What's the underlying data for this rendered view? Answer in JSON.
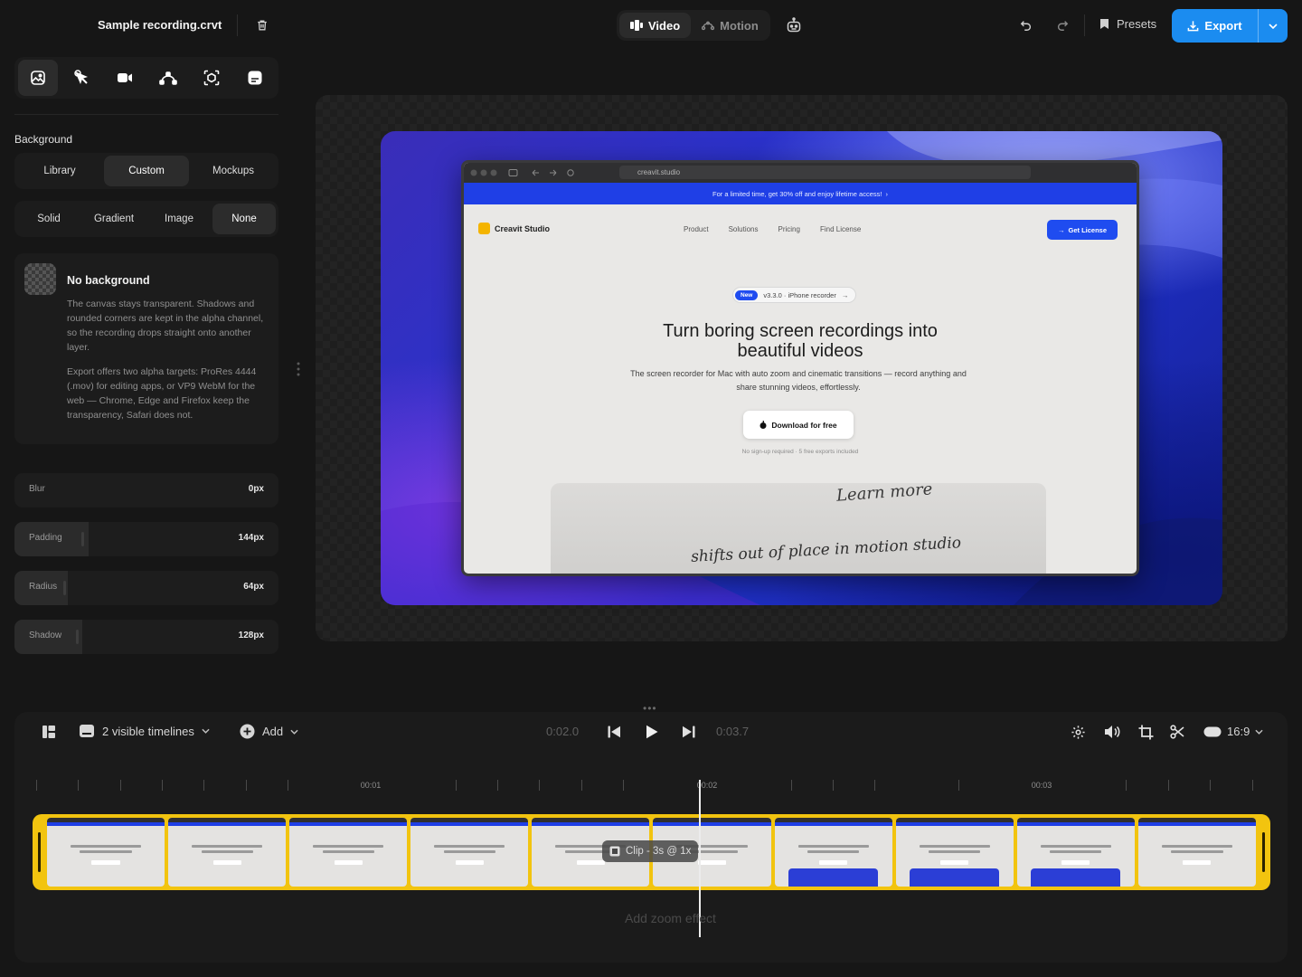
{
  "header": {
    "file_name": "Sample recording.crvt",
    "mode_tabs": [
      {
        "label": "Video",
        "active": true,
        "icon": "video-mode-icon"
      },
      {
        "label": "Motion",
        "active": false,
        "icon": "motion-mode-icon"
      }
    ],
    "presets_label": "Presets",
    "export_label": "Export",
    "accent": "#1b8cf0"
  },
  "sidebar": {
    "tools": [
      "background-icon",
      "cursor-icon",
      "camera-icon",
      "motion-path-icon",
      "focus-icon",
      "captions-icon"
    ],
    "section_title": "Background",
    "source_tabs": [
      {
        "label": "Library",
        "active": false
      },
      {
        "label": "Custom",
        "active": true
      },
      {
        "label": "Mockups",
        "active": false
      }
    ],
    "type_tabs": [
      {
        "label": "Solid",
        "active": false
      },
      {
        "label": "Gradient",
        "active": false
      },
      {
        "label": "Image",
        "active": false
      },
      {
        "label": "None",
        "active": true
      }
    ],
    "info": {
      "title": "No background",
      "p1": "The canvas stays transparent. Shadows and rounded corners are kept in the alpha channel, so the recording drops straight onto another layer.",
      "p2": "Export offers two alpha targets: ProRes 4444 (.mov) for editing apps, or VP9 WebM for the web — Chrome, Edge and Firefox keep the transparency, Safari does not."
    },
    "sliders": [
      {
        "label": "Blur",
        "value": "0px",
        "fraction": 0.0
      },
      {
        "label": "Padding",
        "value": "144px",
        "fraction": 0.28
      },
      {
        "label": "Radius",
        "value": "64px",
        "fraction": 0.2
      },
      {
        "label": "Shadow",
        "value": "128px",
        "fraction": 0.25
      }
    ]
  },
  "preview": {
    "url": "creavit.studio",
    "promo": "For a limited time, get 30% off and enjoy lifetime access!",
    "brand": "Creavit Studio",
    "nav": [
      "Product",
      "Solutions",
      "Pricing",
      "Find License"
    ],
    "cta": "Get License",
    "badge_new": "New",
    "badge_text": "v3.3.0 · iPhone recorder",
    "hero_line1": "Turn boring screen recordings into",
    "hero_line2": "beautiful videos",
    "hero_sub": "The screen recorder for Mac with auto zoom and cinematic transitions — record anything and share stunning videos, effortlessly.",
    "download": "Download for free",
    "fine_print": "No sign-up required · 5 free exports included",
    "img_word1": "Learn more",
    "img_word2": "shifts out of place in motion studio"
  },
  "timeline": {
    "visible_timelines": "2 visible timelines",
    "add_label": "Add",
    "current_time": "0:02.0",
    "end_time": "0:03.7",
    "aspect": "16:9",
    "ruler_labels": [
      "00:01",
      "00:02",
      "00:03"
    ],
    "clip_label": "Clip - 3s @ 1x",
    "add_zoom": "Add zoom effect",
    "clip_color": "#f2c40f"
  }
}
